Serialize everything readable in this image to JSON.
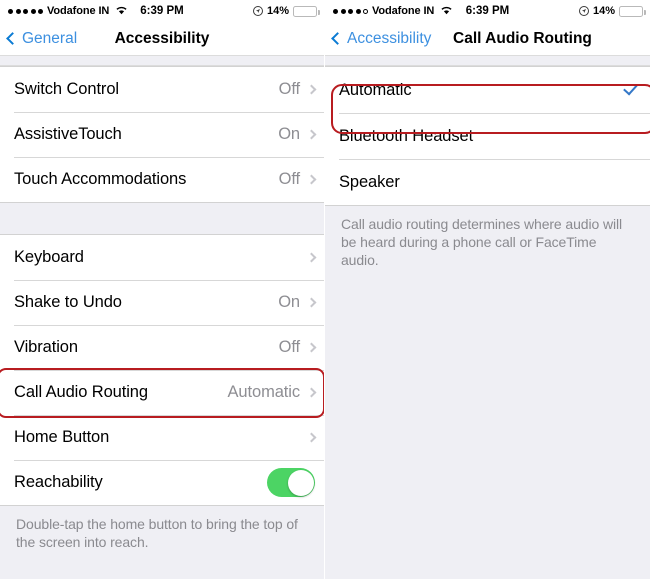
{
  "left": {
    "status_bar": {
      "signal_dots_filled": 5,
      "signal_dots_total": 5,
      "carrier": "Vodafone IN",
      "wifi_icon": "wifi-icon",
      "time": "6:39 PM",
      "location_icon": "location-services-icon",
      "battery_percent": "14%",
      "battery_level": 14
    },
    "nav": {
      "back_icon": "chevron-left-icon",
      "back_label": "General",
      "title": "Accessibility"
    },
    "group1": [
      {
        "label": "Switch Control",
        "value": "Off",
        "accessory": "chevron-right-icon"
      },
      {
        "label": "AssistiveTouch",
        "value": "On",
        "accessory": "chevron-right-icon"
      },
      {
        "label": "Touch Accommodations",
        "value": "Off",
        "accessory": "chevron-right-icon"
      }
    ],
    "group2": [
      {
        "label": "Keyboard",
        "value": "",
        "accessory": "chevron-right-icon"
      },
      {
        "label": "Shake to Undo",
        "value": "On",
        "accessory": "chevron-right-icon"
      },
      {
        "label": "Vibration",
        "value": "Off",
        "accessory": "chevron-right-icon"
      },
      {
        "label": "Call Audio Routing",
        "value": "Automatic",
        "accessory": "chevron-right-icon",
        "highlighted": true
      },
      {
        "label": "Home Button",
        "value": "",
        "accessory": "chevron-right-icon"
      },
      {
        "label": "Reachability",
        "value": "",
        "accessory": "toggle-switch",
        "toggle_on": true
      }
    ],
    "footer": "Double-tap the home button to bring the top of the screen into reach."
  },
  "right": {
    "status_bar": {
      "signal_dots_filled": 4,
      "signal_dots_total": 5,
      "carrier": "Vodafone IN",
      "wifi_icon": "wifi-icon",
      "time": "6:39 PM",
      "location_icon": "location-services-icon",
      "battery_percent": "14%",
      "battery_level": 14
    },
    "nav": {
      "back_icon": "chevron-left-icon",
      "back_label": "Accessibility",
      "title": "Call Audio Routing"
    },
    "options": [
      {
        "label": "Automatic",
        "selected": true,
        "accessory": "checkmark-icon",
        "highlighted": true
      },
      {
        "label": "Bluetooth Headset",
        "selected": false,
        "accessory": ""
      },
      {
        "label": "Speaker",
        "selected": false,
        "accessory": ""
      }
    ],
    "footer": "Call audio routing determines where audio will be heard during a phone call or FaceTime audio."
  },
  "colors": {
    "accent_blue": "#3d90e0",
    "check_blue": "#3478C8",
    "toggle_green": "#4CD464",
    "battery_red": "#E8353B",
    "highlight_red": "#B81C20",
    "group_background": "#EFEFF4",
    "value_gray": "#8e8e93"
  }
}
